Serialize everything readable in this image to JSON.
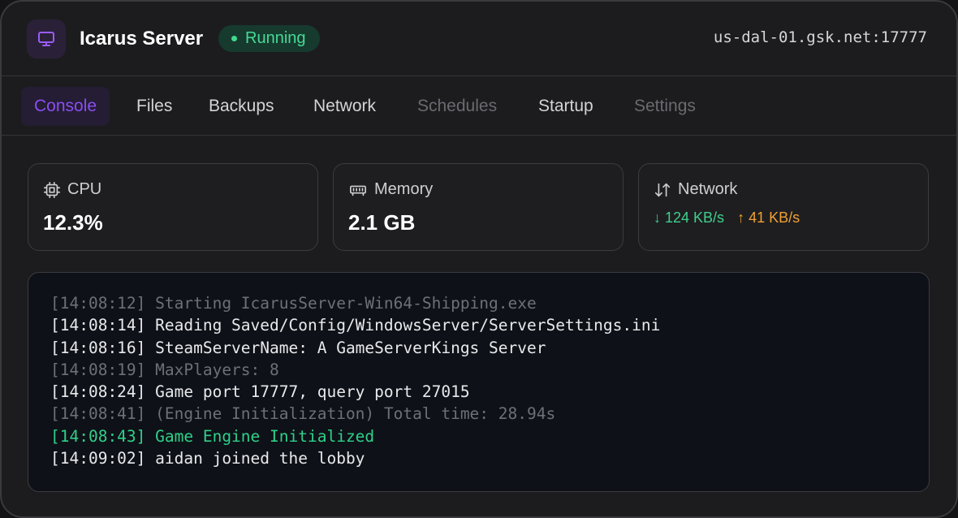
{
  "header": {
    "title": "Icarus Server",
    "status": "Running",
    "address": "us-dal-01.gsk.net:17777",
    "icon": "monitor-icon"
  },
  "tabs": [
    {
      "label": "Console",
      "state": "active"
    },
    {
      "label": "Files",
      "state": "normal"
    },
    {
      "label": "Backups",
      "state": "normal"
    },
    {
      "label": "Network",
      "state": "normal"
    },
    {
      "label": "Schedules",
      "state": "muted"
    },
    {
      "label": "Startup",
      "state": "normal"
    },
    {
      "label": "Settings",
      "state": "muted"
    }
  ],
  "stats": {
    "cpu": {
      "label": "CPU",
      "value": "12.3%",
      "icon": "cpu-icon"
    },
    "memory": {
      "label": "Memory",
      "value": "2.1 GB",
      "icon": "memory-icon"
    },
    "network": {
      "label": "Network",
      "down": "124 KB/s",
      "up": "41 KB/s",
      "icon": "network-arrows-icon"
    }
  },
  "console": {
    "lines": [
      {
        "text": "[14:08:12] Starting IcarusServer-Win64-Shipping.exe",
        "style": "dim"
      },
      {
        "text": "[14:08:14] Reading Saved/Config/WindowsServer/ServerSettings.ini",
        "style": "normal"
      },
      {
        "text": "[14:08:16] SteamServerName: A GameServerKings Server",
        "style": "normal"
      },
      {
        "text": "[14:08:19] MaxPlayers: 8",
        "style": "dim"
      },
      {
        "text": "[14:08:24] Game port 17777, query port 27015",
        "style": "normal"
      },
      {
        "text": "[14:08:41] (Engine Initialization) Total time: 28.94s",
        "style": "dim"
      },
      {
        "text": "[14:08:43] Game Engine Initialized",
        "style": "success"
      },
      {
        "text": "[14:09:02] aidan joined the lobby",
        "style": "normal"
      }
    ]
  },
  "colors": {
    "accent": "#8b4df2",
    "running": "#47d995",
    "download": "#3fcf8c",
    "upload": "#f0a032"
  }
}
